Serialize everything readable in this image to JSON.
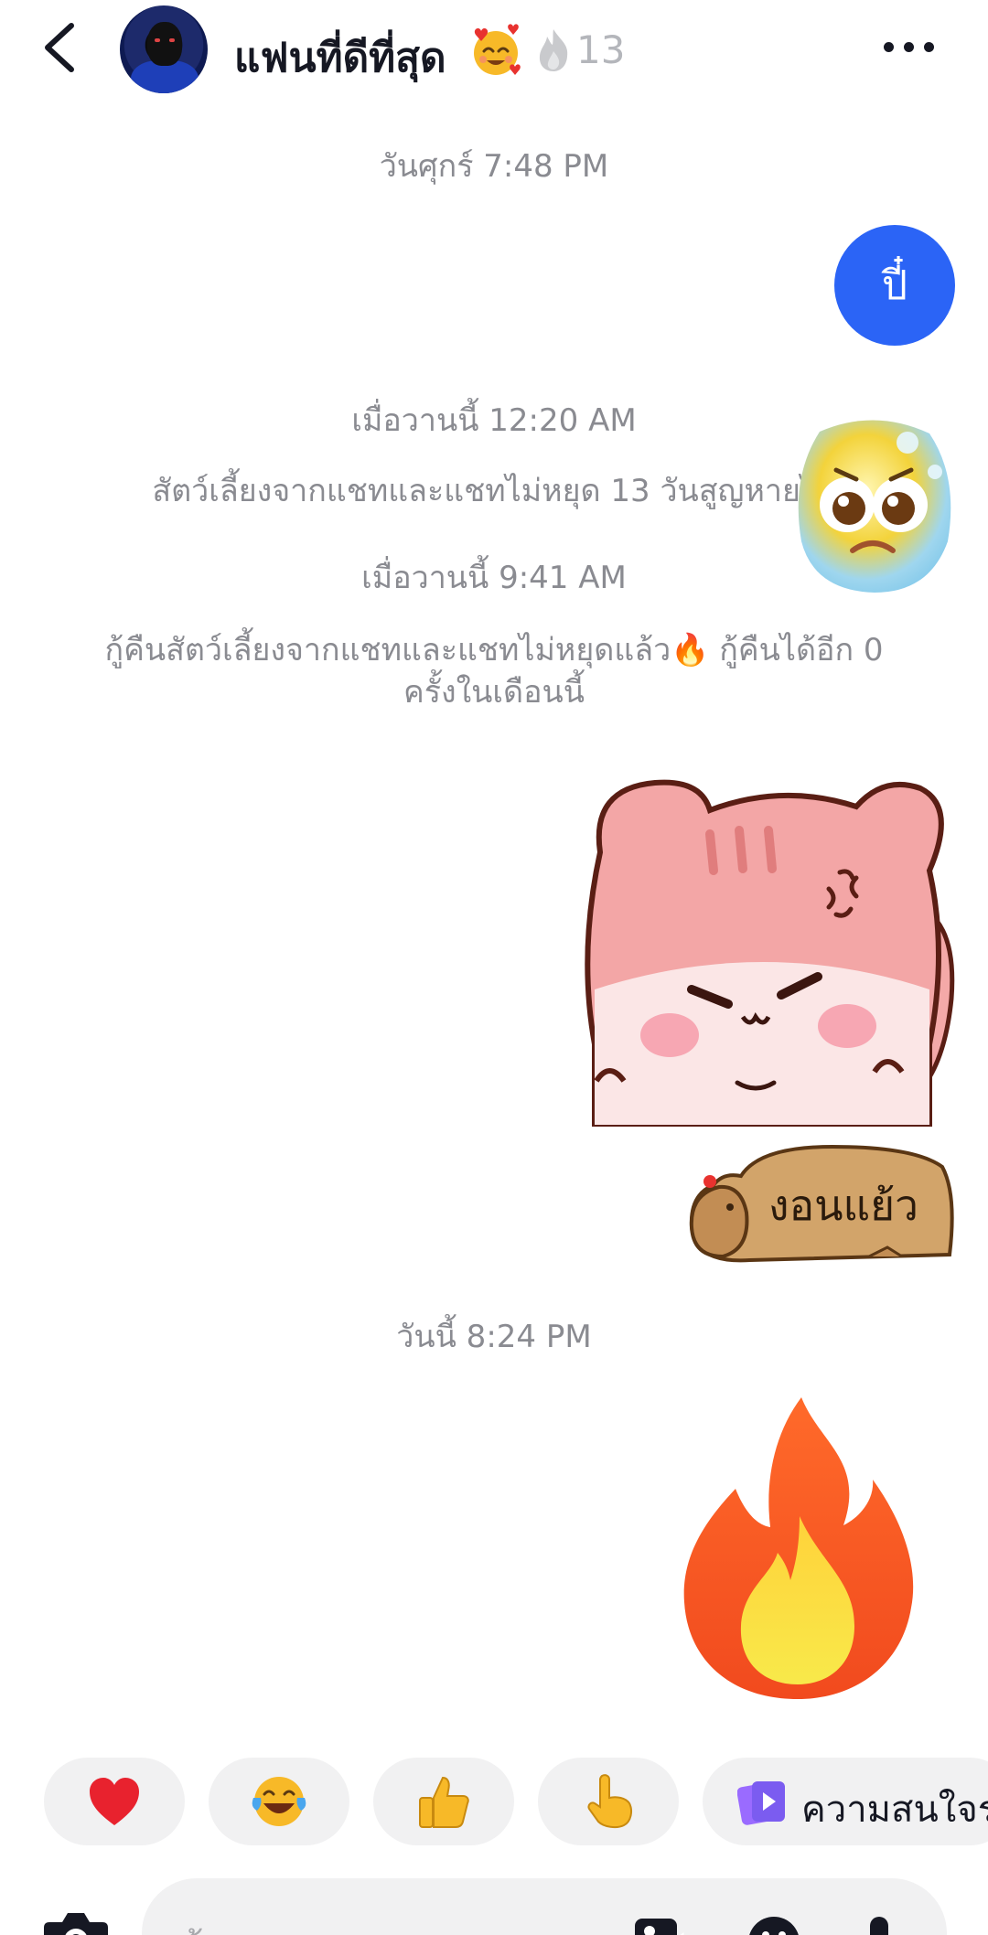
{
  "header": {
    "chat_name": "แฟนที่ดีที่สุด",
    "streak_count": "13",
    "icons": [
      "back-arrow-icon",
      "smiling-face-with-hearts-icon",
      "flame-icon",
      "more-icon"
    ]
  },
  "messages": {
    "timestamp_1": "วันศุกร์ 7:48 PM",
    "bubble_1_text": "ปี๋",
    "timestamp_2": "เมื่อวานนี้ 12:20 AM",
    "system_1": "สัตว์เลี้ยงจากแชทและแชทไม่หยุด 13 วันสูญหายไป",
    "timestamp_3": "เมื่อวานนี้ 9:41 AM",
    "system_2_line1": "กู้คืนสัตว์เลี้ยงจากแชทและแชทไม่หยุดแล้ว🔥 กู้คืนได้อีก 0",
    "system_2_line2": "ครั้งในเดือนนี้",
    "sticker_capybara_text": "งอนแย้ว",
    "timestamp_4": "วันนี้ 8:24 PM"
  },
  "quick_reactions": {
    "items": [
      "heart-icon",
      "tears-of-joy-icon",
      "thumbs-up-icon",
      "pointing-hand-icon"
    ],
    "interests_label": "ความสนใจร่"
  },
  "composer": {
    "placeholder": "ข้อความ"
  },
  "colors": {
    "accent_blue": "#2b64f6",
    "text_primary": "#161823",
    "text_secondary": "#8a8b91",
    "chip_bg": "#f1f1f2"
  }
}
